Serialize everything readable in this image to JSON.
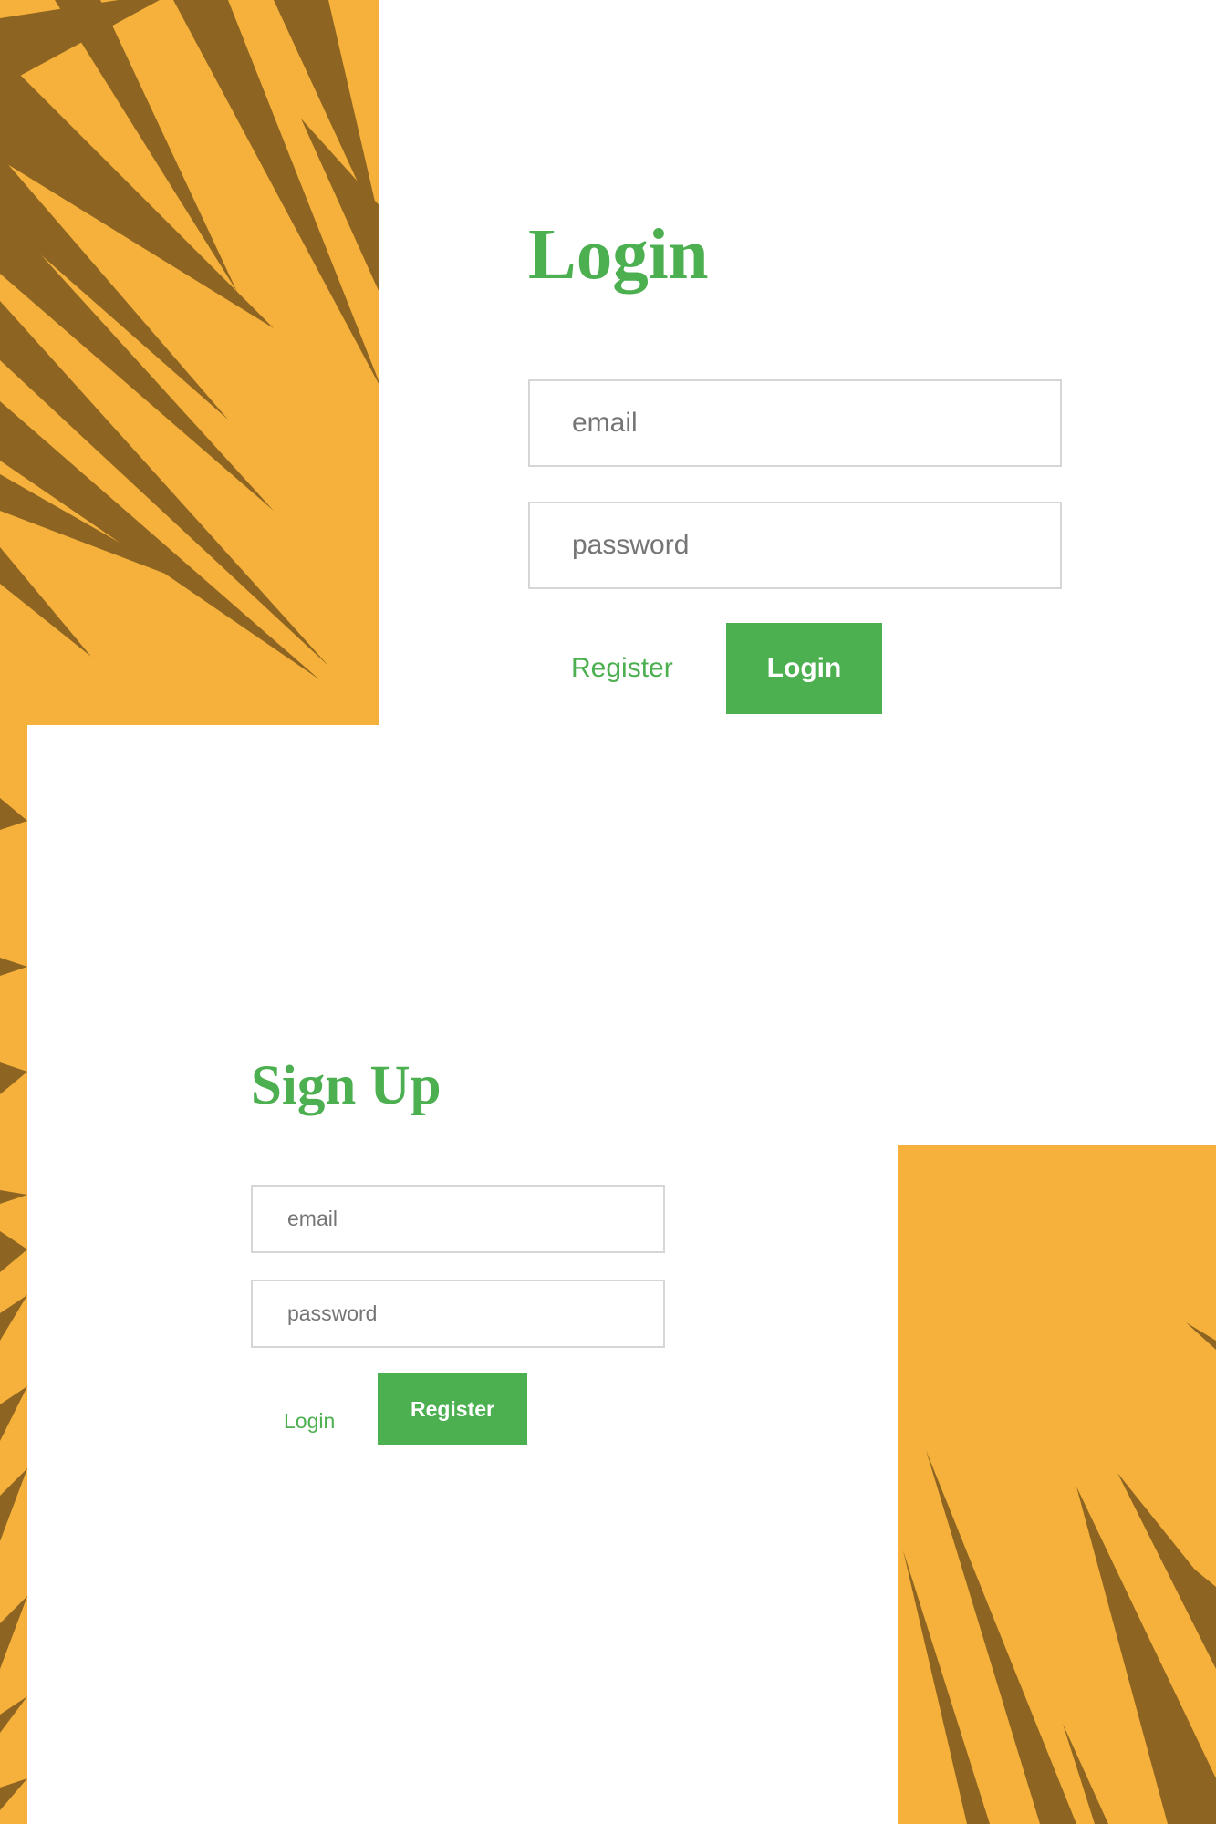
{
  "theme": {
    "background_color": "#f5b13b",
    "ray_color": "#8d6421",
    "accent_color": "#4caf50",
    "panel_color": "#ffffff"
  },
  "login_form": {
    "title": "Login",
    "email_placeholder": "email",
    "password_placeholder": "password",
    "register_link": "Register",
    "login_button": "Login"
  },
  "signup_form": {
    "title": "Sign Up",
    "email_placeholder": "email",
    "password_placeholder": "password",
    "login_link": "Login",
    "register_button": "Register"
  }
}
